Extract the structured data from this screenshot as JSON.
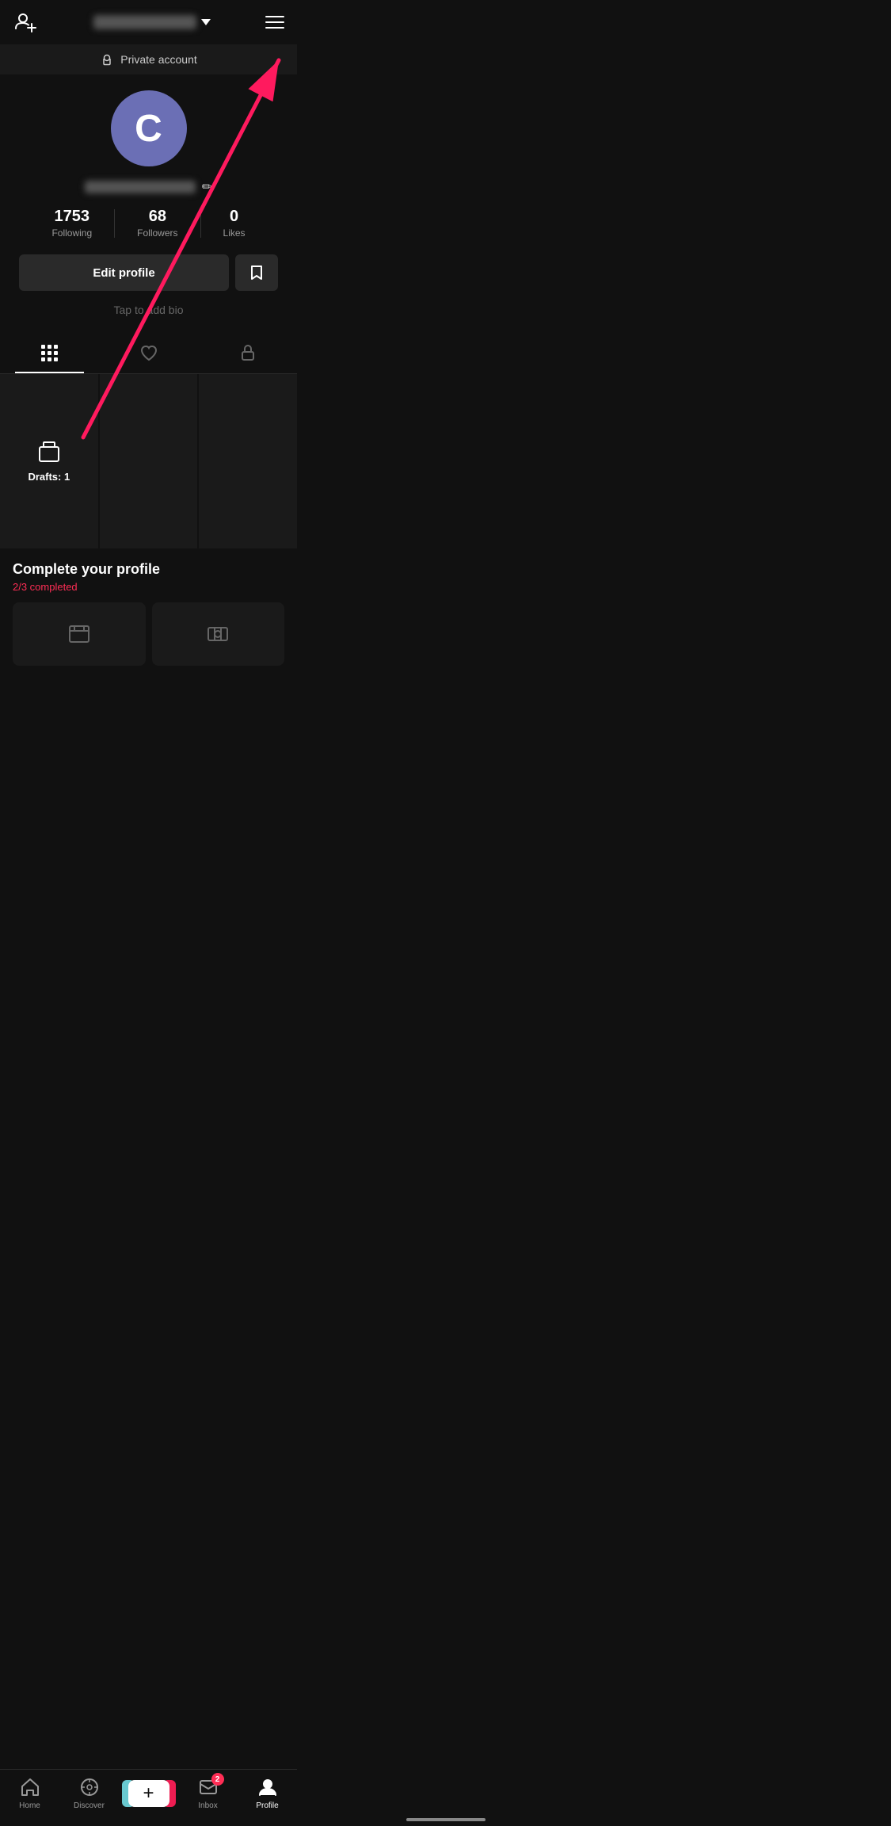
{
  "header": {
    "add_user_label": "Add user",
    "chevron_label": "dropdown",
    "menu_label": "Menu"
  },
  "private_banner": {
    "icon": "lock-icon",
    "text": "Private account"
  },
  "profile": {
    "avatar_letter": "C",
    "username_placeholder": "username",
    "edit_icon": "✏",
    "stats": {
      "following": {
        "count": "1753",
        "label": "Following"
      },
      "followers": {
        "count": "68",
        "label": "Followers"
      },
      "likes": {
        "count": "0",
        "label": "Likes"
      }
    },
    "edit_profile_label": "Edit profile",
    "bookmark_label": "Bookmark",
    "add_bio_text": "Tap to add bio"
  },
  "tabs": [
    {
      "id": "grid",
      "label": "Grid",
      "active": true
    },
    {
      "id": "liked",
      "label": "Liked",
      "active": false
    },
    {
      "id": "private",
      "label": "Private",
      "active": false
    }
  ],
  "drafts": {
    "label": "Drafts: 1"
  },
  "complete_profile": {
    "title": "Complete your profile",
    "subtitle": "2/3 completed"
  },
  "bottom_nav": {
    "items": [
      {
        "id": "home",
        "label": "Home",
        "active": false
      },
      {
        "id": "discover",
        "label": "Discover",
        "active": false
      },
      {
        "id": "create",
        "label": "",
        "active": false
      },
      {
        "id": "inbox",
        "label": "Inbox",
        "active": false,
        "badge": "2"
      },
      {
        "id": "profile",
        "label": "Profile",
        "active": true
      }
    ]
  }
}
